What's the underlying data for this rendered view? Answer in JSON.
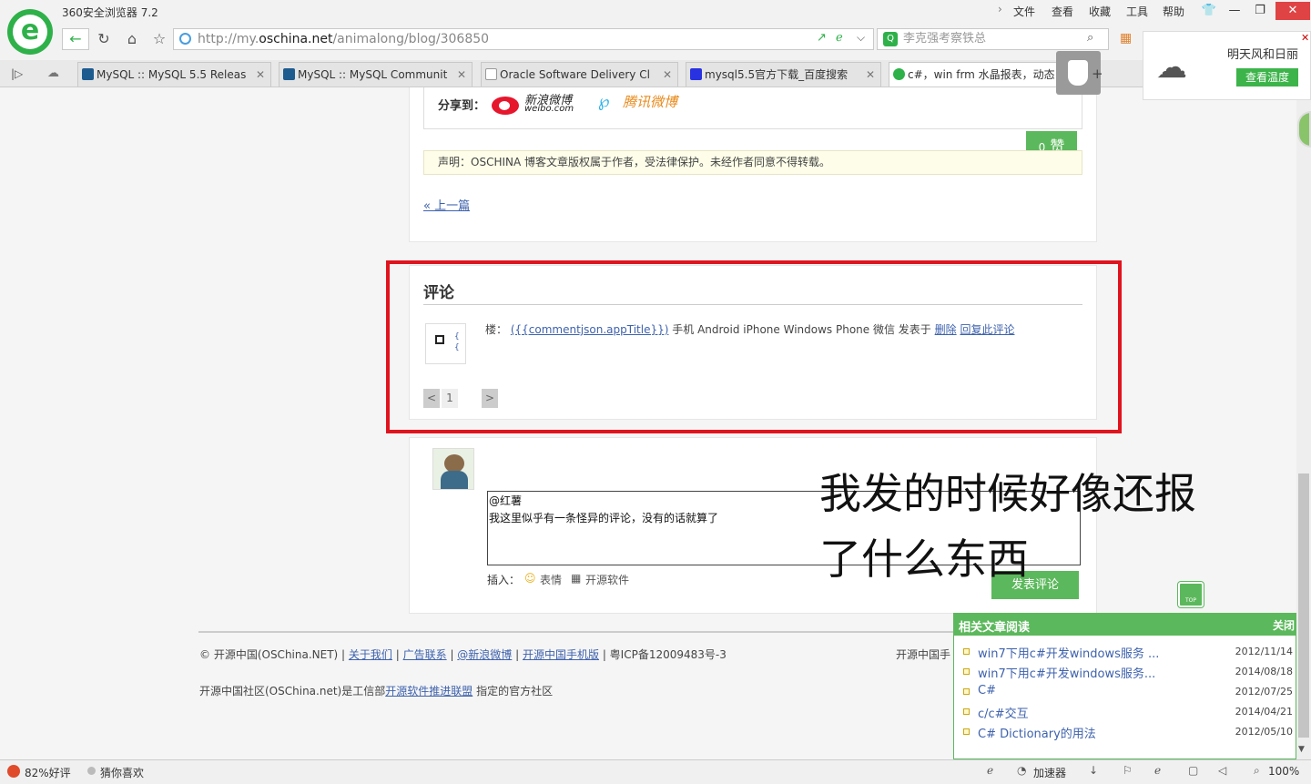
{
  "browser": {
    "app_title": "360安全浏览器 7.2",
    "menu": [
      "文件",
      "查看",
      "收藏",
      "工具",
      "帮助"
    ],
    "url_prefix": "http://my.",
    "url_domain": "oschina.net",
    "url_path": "/animalong/blog/306850",
    "search_text": "李克强考察铁总",
    "tabs": [
      {
        "label": "MySQL :: MySQL 5.5 Releas"
      },
      {
        "label": "MySQL :: MySQL Communit"
      },
      {
        "label": "Oracle Software Delivery Cl"
      },
      {
        "label": "mysql5.5官方下载_百度搜索"
      },
      {
        "label": "c#，win frm 水晶报表，动态"
      }
    ],
    "weather_text": "明天风和日丽",
    "weather_button": "查看温度"
  },
  "article": {
    "share_label": "分享到：",
    "weibo_name": "新浪微博",
    "weibo_sub": "weibo.com",
    "tencent_name": "腾讯微博",
    "like_count": "0",
    "like_label": "赞",
    "notice": "声明：OSCHINA 博客文章版权属于作者，受法律保护。未经作者同意不得转载。",
    "prev_link": "« 上一篇"
  },
  "comments": {
    "title": "评论",
    "floor_label": "楼：",
    "app_title_template": "({{commentjson.appTitle}})",
    "platforms": "手机 Android iPhone Windows Phone 微信 发表于",
    "delete_link": "删除",
    "reply_link": "回复此评论",
    "avatar_text": "{ {",
    "pager": {
      "prev": "<",
      "page": "1",
      "next": ">"
    }
  },
  "reply": {
    "textarea_value": "@红薯\n我这里似乎有一条怪异的评论，没有的话就算了",
    "insert_label": "插入：",
    "emoji_label": "表情",
    "software_label": "开源软件",
    "submit_label": "发表评论"
  },
  "annotation": {
    "line1": "我发的时候好像还报",
    "line2": "了什么东西"
  },
  "footer": {
    "copyright": "© 开源中国(OSChina.NET) |",
    "links": [
      "关于我们",
      "广告联系",
      "@新浪微博",
      "开源中国手机版"
    ],
    "icp": "| 粤ICP备12009483号-3",
    "line2_prefix": "开源中国社区(OSChina.net)是工信部",
    "line2_link": "开源软件推进联盟",
    "line2_suffix": "指定的官方社区",
    "right_text": "开源中国手"
  },
  "related": {
    "title": "相关文章阅读",
    "close": "关闭",
    "items": [
      {
        "title": "win7下用c#开发windows服务 ...",
        "date": "2012/11/14"
      },
      {
        "title": "win7下用c#开发windows服务...",
        "date": "2014/08/18"
      },
      {
        "title": "C#",
        "date": "2012/07/25"
      },
      {
        "title": "c/c#交互",
        "date": "2014/04/21"
      },
      {
        "title": "C# Dictionary的用法",
        "date": "2012/05/10"
      }
    ]
  },
  "top_button": "TOP",
  "statusbar": {
    "rating": "82%好评",
    "guess": "猜你喜欢",
    "accelerator": "加速器",
    "zoom": "100%"
  },
  "colors": {
    "accent_green": "#5cb85c",
    "highlight_red": "#e0141e",
    "link_blue": "#3e62ad"
  }
}
